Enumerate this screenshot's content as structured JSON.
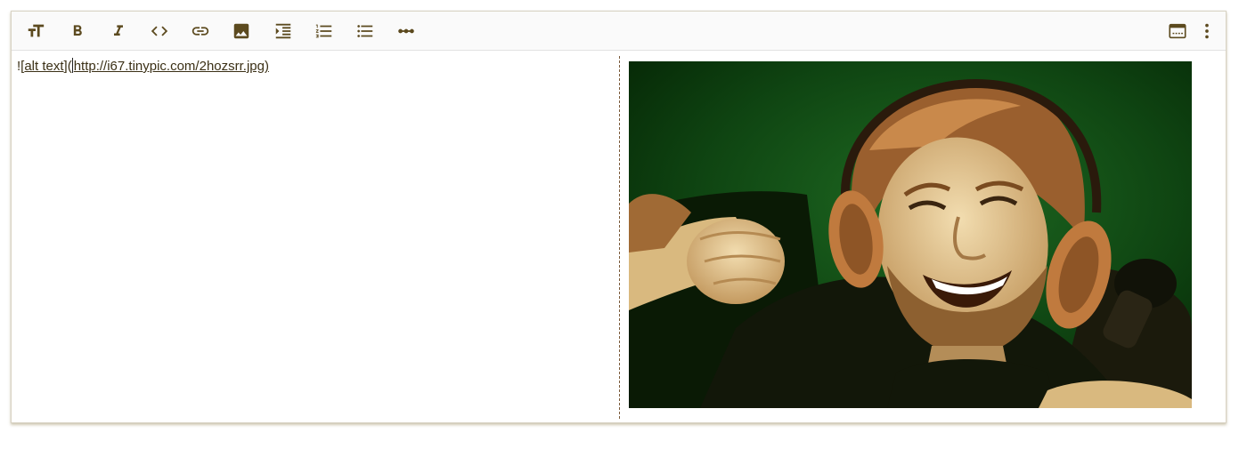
{
  "toolbar": {
    "left_buttons": [
      {
        "name": "heading-button",
        "icon": "text-size-icon",
        "title": "Heading"
      },
      {
        "name": "bold-button",
        "icon": "bold-icon",
        "title": "Bold"
      },
      {
        "name": "italic-button",
        "icon": "italic-icon",
        "title": "Italic"
      },
      {
        "name": "code-button",
        "icon": "code-icon",
        "title": "Code"
      },
      {
        "name": "link-button",
        "icon": "link-icon",
        "title": "Link"
      },
      {
        "name": "image-button",
        "icon": "image-icon",
        "title": "Image"
      },
      {
        "name": "indent-button",
        "icon": "indent-icon",
        "title": "Indent"
      },
      {
        "name": "ordered-list-button",
        "icon": "numbered-list-icon",
        "title": "Ordered list"
      },
      {
        "name": "unordered-list-button",
        "icon": "bulleted-list-icon",
        "title": "Unordered list"
      },
      {
        "name": "horizontal-rule-button",
        "icon": "horizontal-rule-icon",
        "title": "Horizontal rule"
      }
    ],
    "right_buttons": [
      {
        "name": "toggle-preview-button",
        "icon": "split-view-icon",
        "title": "Toggle preview"
      },
      {
        "name": "more-options-button",
        "icon": "more-vert-icon",
        "title": "More"
      }
    ]
  },
  "editor": {
    "prefix": "![",
    "alt_text": "alt text",
    "middle": "](",
    "url_text": "http://i67.tinypic.com/2hozsrr.jpg)"
  },
  "preview": {
    "image_alt": "alt text",
    "image_subject": "smiling man with headphones raising fist, green background"
  },
  "colors": {
    "icon": "#5c4a1f",
    "text": "#3b3016",
    "image_background": "#0d3d0f"
  }
}
